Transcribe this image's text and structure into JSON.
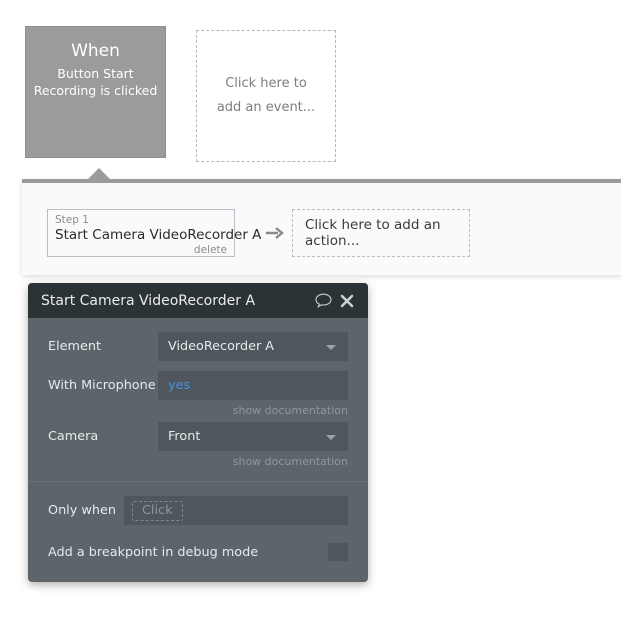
{
  "canvas": {
    "event_block": {
      "title": "When",
      "subtitle": "Button Start Recording is clicked"
    },
    "add_event_placeholder": "Click here to add an event...",
    "step": {
      "label": "Step 1",
      "name": "Start Camera VideoRecorder A",
      "delete_label": "delete"
    },
    "arrow_icon": "arrow-right-icon",
    "add_action_placeholder": "Click here to add an action..."
  },
  "property_panel": {
    "title": "Start Camera VideoRecorder A",
    "comment_icon": "speech-bubble-icon",
    "close_icon": "close-icon",
    "fields": [
      {
        "label": "Element",
        "value": "VideoRecorder A",
        "type": "dropdown"
      },
      {
        "label": "With Microphone",
        "value": "yes",
        "type": "expression",
        "doc_link": "show documentation"
      },
      {
        "label": "Camera",
        "value": "Front",
        "type": "dropdown",
        "doc_link": "show documentation"
      }
    ],
    "only_when": {
      "label": "Only when",
      "placeholder": "Click"
    },
    "breakpoint": {
      "label": "Add a breakpoint in debug mode",
      "checked": false
    }
  },
  "colors": {
    "event_block_bg": "#9b9b9b",
    "panel_bg": "#5d656a",
    "panel_header_bg": "#2c3337",
    "field_bg": "#4f575c",
    "accent_blue": "#4a90e2",
    "canvas_bg": "#ffffff",
    "actions_row_bg": "#fafafa"
  }
}
